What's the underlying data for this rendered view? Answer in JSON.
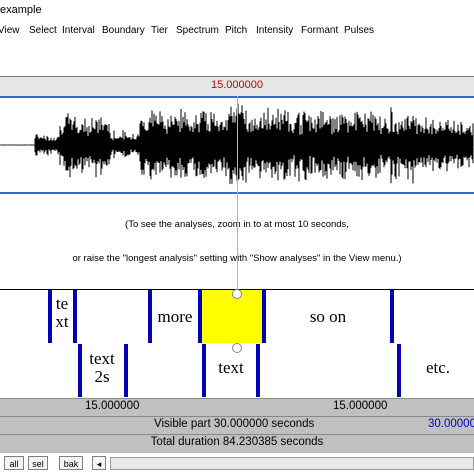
{
  "window": {
    "title": "example"
  },
  "menu": [
    "View",
    "Select",
    "Interval",
    "Boundary",
    "Tier",
    "Spectrum",
    "Pitch",
    "Intensity",
    "Formant",
    "Pulses"
  ],
  "cursor": {
    "time": "15.000000"
  },
  "analysis_message": {
    "line1": "(To see the analyses, zoom in to at most 10 seconds,",
    "line2": "or raise the \"longest analysis\" setting with \"Show analyses\" in the View menu.)"
  },
  "tier1": {
    "intervals": [
      "te\nxt",
      "more",
      "so on"
    ]
  },
  "tier2": {
    "intervals": [
      "text\n2s",
      "text",
      "etc."
    ]
  },
  "time_row": {
    "left": "15.000000",
    "right": "15.000000"
  },
  "visible_row": {
    "label": "Visible part 30.000000 seconds",
    "right_value": "30.00000"
  },
  "total_row": {
    "label": "Total duration 84.230385 seconds"
  },
  "controls": {
    "all": "all",
    "sel": "sel",
    "bak": "bak"
  },
  "colors": {
    "selection": "#ffff00",
    "boundary": "#0000b4",
    "cursor_time": "#d00000",
    "blue_value": "#0000cc"
  }
}
